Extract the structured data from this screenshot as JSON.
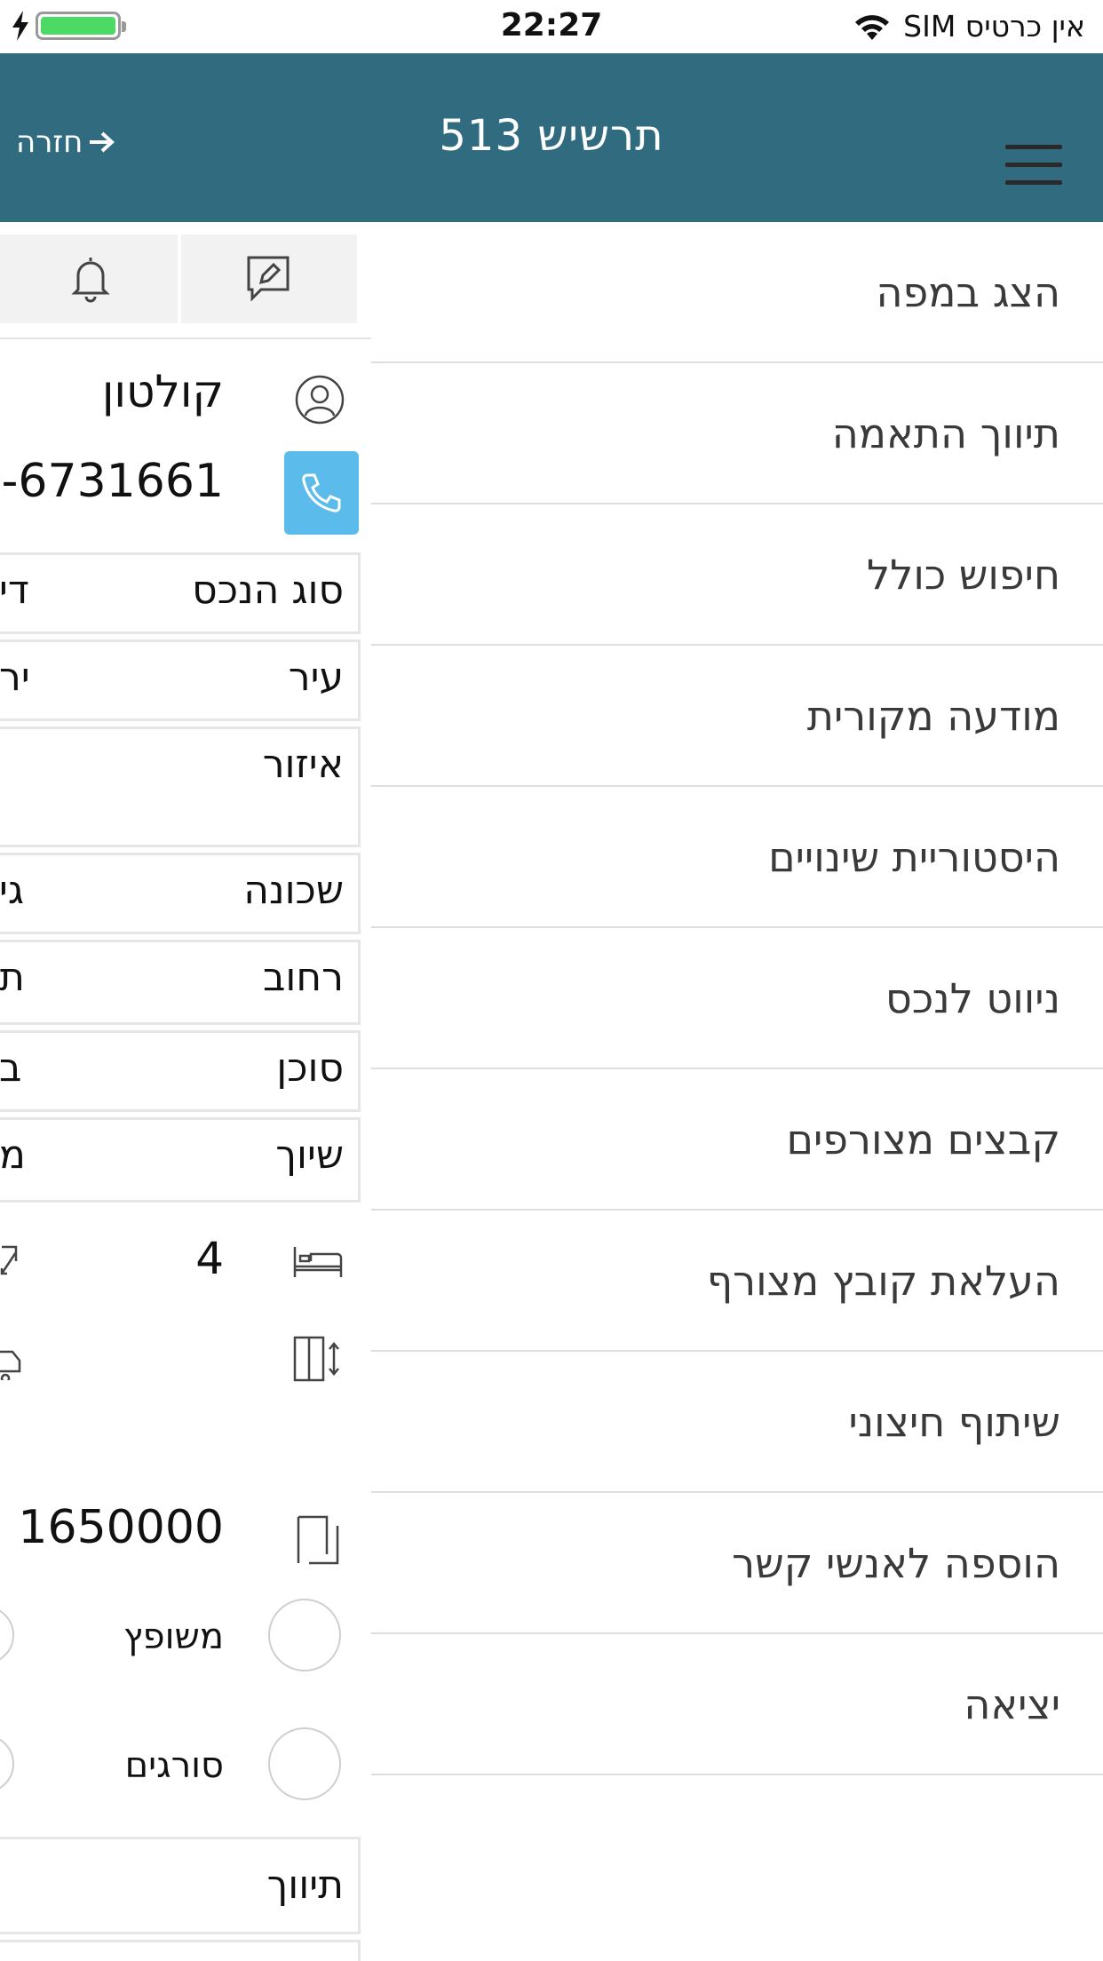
{
  "status_bar": {
    "time": "22:27",
    "carrier": "אין כרטיס SIM"
  },
  "header": {
    "title": "תרשיש 513",
    "back_label": "חזרה"
  },
  "detail": {
    "contact_name": "קולטון",
    "phone": "-6731661",
    "fields": [
      {
        "label": "סוג הנכס",
        "value": "די"
      },
      {
        "label": "עיר",
        "value": "יר"
      },
      {
        "label": "איזור",
        "value": ""
      },
      {
        "label": "שכונה",
        "value": "גי"
      },
      {
        "label": "רחוב",
        "value": "ת"
      },
      {
        "label": "סוכן",
        "value": "ב"
      },
      {
        "label": "שיוך",
        "value": "מ"
      }
    ],
    "rooms": "4",
    "price": "1650000",
    "checkboxes": [
      "משופץ",
      "סורגים"
    ],
    "tagging_label": "תיווך"
  },
  "menu": {
    "items": [
      "הצג במפה",
      "תיווך התאמה",
      "חיפוש כולל",
      "מודעה מקורית",
      "היסטוריית שינויים",
      "ניווט לנכס",
      "קבצים מצורפים",
      "העלאת קובץ מצורף",
      "שיתוף חיצוני",
      "הוספה לאנשי קשר",
      "יציאה"
    ]
  },
  "colors": {
    "header_bg": "#316b80",
    "call_button": "#5bbcec",
    "battery": "#4cd964"
  }
}
